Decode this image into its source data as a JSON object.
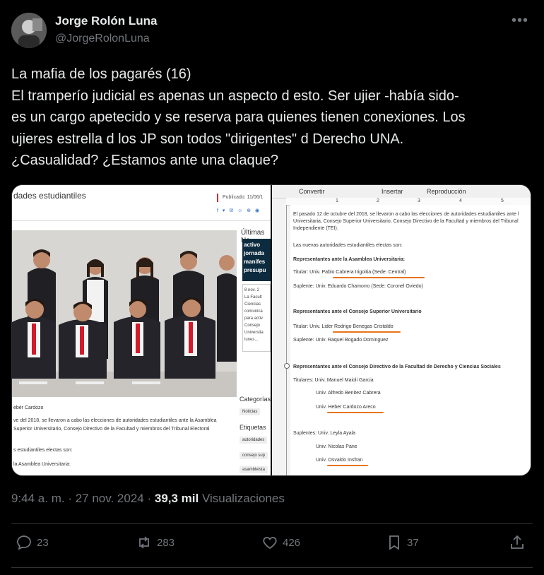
{
  "author": {
    "name": "Jorge Rolón Luna",
    "handle": "@JorgeRolonLuna"
  },
  "tweet": {
    "lines": [
      "La  mafia de los pagarés (16)",
      "El tramperío judicial es apenas un aspecto d esto. Ser ujier -había sido-",
      "es un cargo apetecido y se reserva para quienes tienen conexiones. Los",
      "ujieres estrella d los JP son todos \"dirigentes\" d Derecho UNA.",
      "¿Casualidad? ¿Estamos ante una claque?"
    ]
  },
  "meta": {
    "time": "9:44 a. m. · 27 nov. 2024 · ",
    "views_count": "39,3 mil",
    "views_label": " Visualizaciones"
  },
  "actions": {
    "replies": "23",
    "reposts": "283",
    "likes": "426",
    "bookmarks": "37"
  },
  "media_left": {
    "heading": "dades estudiantiles",
    "published": "Publicado: 11/06/1",
    "latest": "Últimas No",
    "blue_lines": [
      "activo",
      "jornada",
      "manifes",
      "presupu"
    ],
    "news_date": "8 nov. 2",
    "news_lines": [
      "La Facult",
      "Ciencias",
      "comunica",
      "para activ",
      "Consejo",
      "Universita",
      "lunes..."
    ],
    "categories": "Categorías",
    "tag_news": "Noticias",
    "labels": "Etiquetas",
    "tags": [
      "autoridades",
      "consejo sup",
      "asambleista"
    ],
    "body_lines": [
      "ebér Cardozo",
      "ve del 2018, se llevaron a cabo las elecciones de autoridades estudiantiles ante la Asamblea",
      "Superior Universitario, Consejo Directivo de la Facultad y miembros del Tribunal Electoral",
      "s estudiantiles electas son:",
      "la Asamblea Universitaria:"
    ]
  },
  "media_right": {
    "menu": [
      "Convertir",
      "Insertar",
      "Reproducción"
    ],
    "ruler": [
      "1",
      "2",
      "3",
      "4",
      "5"
    ],
    "lines": [
      "El pasado 12 de octubre del 2018, se llevaron a cabo las elecciones de autoridades estudiantiles ante l",
      "Universitaria, Consejo Superior Universitario, Consejo Directivo de la Facultad y miembros del Tribunal",
      "Independiente (TEI).",
      "Las nuevas autoridades estudiantiles electas son:",
      "Representantes ante la Asamblea Universitaria:",
      "Titular: Univ. Pablo Cabrera Irigoitia (Sede: Central)",
      "Suplente: Univ. Eduardo Chamorro (Sede: Coronel Oviedo)",
      "Representantes ante el Consejo Superior Universitario",
      "Titular: Univ. Lider Rodrigo Benegas Cristaldo",
      "Suplente: Univ. Raquel Bogado Dominguez",
      "Representantes ante el Consejo Directivo de la Facultad de Derecho y Ciencias Sociales",
      "Titulares: Univ. Manuel Maioli Garcia",
      "Univ. Alfredo Benitez Cabrera",
      "Univ. Heber Cardozo Areco",
      "Suplentes: Univ. Leyla Ayala",
      "Univ. Nicolas Pane",
      "Univ. Osvaldo Insfran"
    ]
  }
}
